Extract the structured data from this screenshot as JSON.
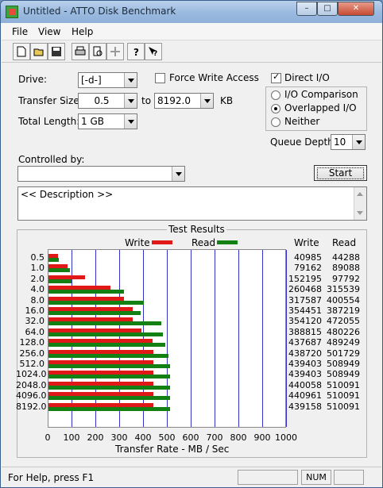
{
  "window": {
    "title": "Untitled - ATTO Disk Benchmark",
    "min_label": "–",
    "max_label": "□",
    "close_label": "✕"
  },
  "menu": [
    "File",
    "View",
    "Help"
  ],
  "toolbar": [
    "new-file-icon",
    "open-folder-icon",
    "save-icon",
    "print-icon",
    "print-preview-icon",
    "move-icon",
    "help-icon",
    "context-help-icon"
  ],
  "form": {
    "drive_label": "Drive:",
    "drive_value": "[-d-]",
    "force_write_label": "Force Write Access",
    "force_write_checked": false,
    "direct_io_label": "Direct I/O",
    "direct_io_checked": true,
    "transfer_size_label": "Transfer Size:",
    "transfer_from": "0.5",
    "to_label": "to",
    "transfer_to": "8192.0",
    "unit_label": "KB",
    "total_length_label": "Total Length:",
    "total_length_value": "1 GB",
    "io_options": [
      {
        "label": "I/O Comparison",
        "selected": false
      },
      {
        "label": "Overlapped I/O",
        "selected": true
      },
      {
        "label": "Neither",
        "selected": false
      }
    ],
    "queue_depth_label": "Queue Depth:",
    "queue_depth_value": "10",
    "controlled_by_label": "Controlled by:",
    "controlled_by_value": "",
    "start_label": "Start",
    "description": "<< Description >>"
  },
  "results": {
    "title": "Test Results",
    "legend_write": "Write",
    "legend_read": "Read",
    "col_write": "Write",
    "col_read": "Read",
    "write_color": "#e11818",
    "read_color": "#128012",
    "x_axis_label": "Transfer Rate - MB / Sec"
  },
  "chart_data": {
    "type": "bar",
    "orientation": "horizontal",
    "categories": [
      "0.5",
      "1.0",
      "2.0",
      "4.0",
      "8.0",
      "16.0",
      "32.0",
      "64.0",
      "128.0",
      "256.0",
      "512.0",
      "1024.0",
      "2048.0",
      "4096.0",
      "8192.0"
    ],
    "series": [
      {
        "name": "Write",
        "values": [
          40985,
          79162,
          152195,
          260468,
          317587,
          354451,
          354120,
          388815,
          437687,
          438720,
          439403,
          439403,
          440058,
          440961,
          439158
        ]
      },
      {
        "name": "Read",
        "values": [
          44288,
          89088,
          97792,
          315539,
          400554,
          387219,
          472055,
          480226,
          489249,
          501729,
          508949,
          508949,
          510091,
          510091,
          510091
        ]
      }
    ],
    "value_unit_divisor": 1000,
    "xlabel": "Transfer Rate - MB / Sec",
    "xlim": [
      0,
      1000
    ],
    "xticks": [
      "0",
      "100",
      "200",
      "300",
      "400",
      "500",
      "600",
      "700",
      "800",
      "900",
      "1000"
    ]
  },
  "status": {
    "text": "For Help, press F1",
    "num": "NUM"
  }
}
